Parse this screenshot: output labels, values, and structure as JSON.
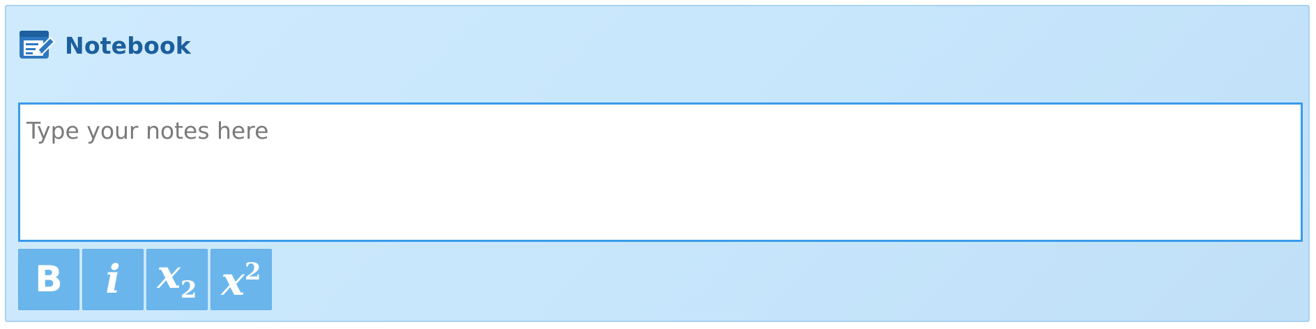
{
  "notebook": {
    "title": "Notebook",
    "icon": "notebook-edit-icon",
    "notes_value": "",
    "notes_placeholder": "Type your notes here"
  },
  "toolbar": {
    "buttons": [
      {
        "id": "bold",
        "glyph": "B",
        "icon": "bold-icon"
      },
      {
        "id": "italic",
        "glyph": "i",
        "icon": "italic-icon"
      },
      {
        "id": "subscript",
        "glyph": "x",
        "script": "2",
        "icon": "subscript-icon"
      },
      {
        "id": "superscript",
        "glyph": "x",
        "script": "2",
        "icon": "superscript-icon"
      }
    ]
  },
  "colors": {
    "panel_background": "#c7e6fc",
    "panel_border": "#a9d2f0",
    "title_text": "#1c5f9c",
    "notes_border": "#3a9bea",
    "button_background": "#6ab6ec",
    "button_text": "#ffffff"
  }
}
